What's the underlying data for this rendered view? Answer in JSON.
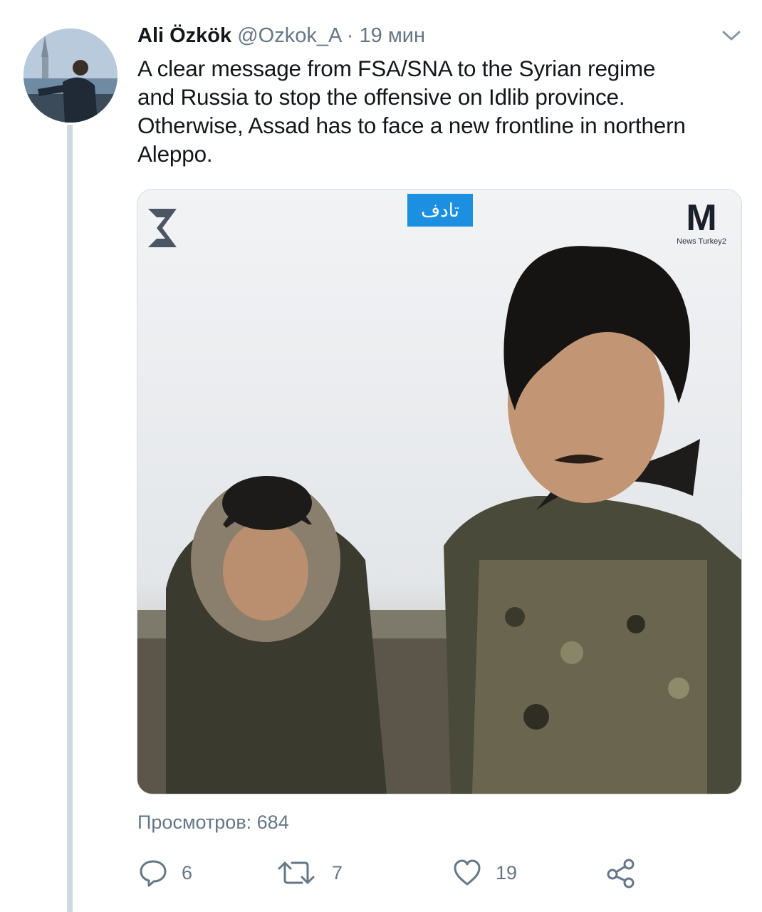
{
  "tweet": {
    "author_name": "Ali Özkök",
    "handle": "@Ozkok_A",
    "separator": "·",
    "time": "19 мин",
    "text": "A clear message from FSA/SNA to the Syrian regime\nand Russia to stop the offensive on Idlib province.\nOtherwise, Assad has to face a new frontline in northern\nAleppo."
  },
  "media": {
    "overlay_tag": "تادف",
    "logo_letter": "M",
    "logo_brand": "News Turkey2"
  },
  "views_label": "Просмотров: 684",
  "actions": {
    "reply_count": "6",
    "retweet_count": "7",
    "like_count": "19"
  },
  "icons": {
    "avatar": "avatar-photo",
    "menu": "chevron-down-icon",
    "reply": "reply-icon",
    "retweet": "retweet-icon",
    "like": "heart-icon",
    "share": "share-icon"
  },
  "colors": {
    "text": "#14171a",
    "secondary": "#657786",
    "thread_line": "#cfd9de",
    "tag_blue": "#1c8fe0"
  }
}
